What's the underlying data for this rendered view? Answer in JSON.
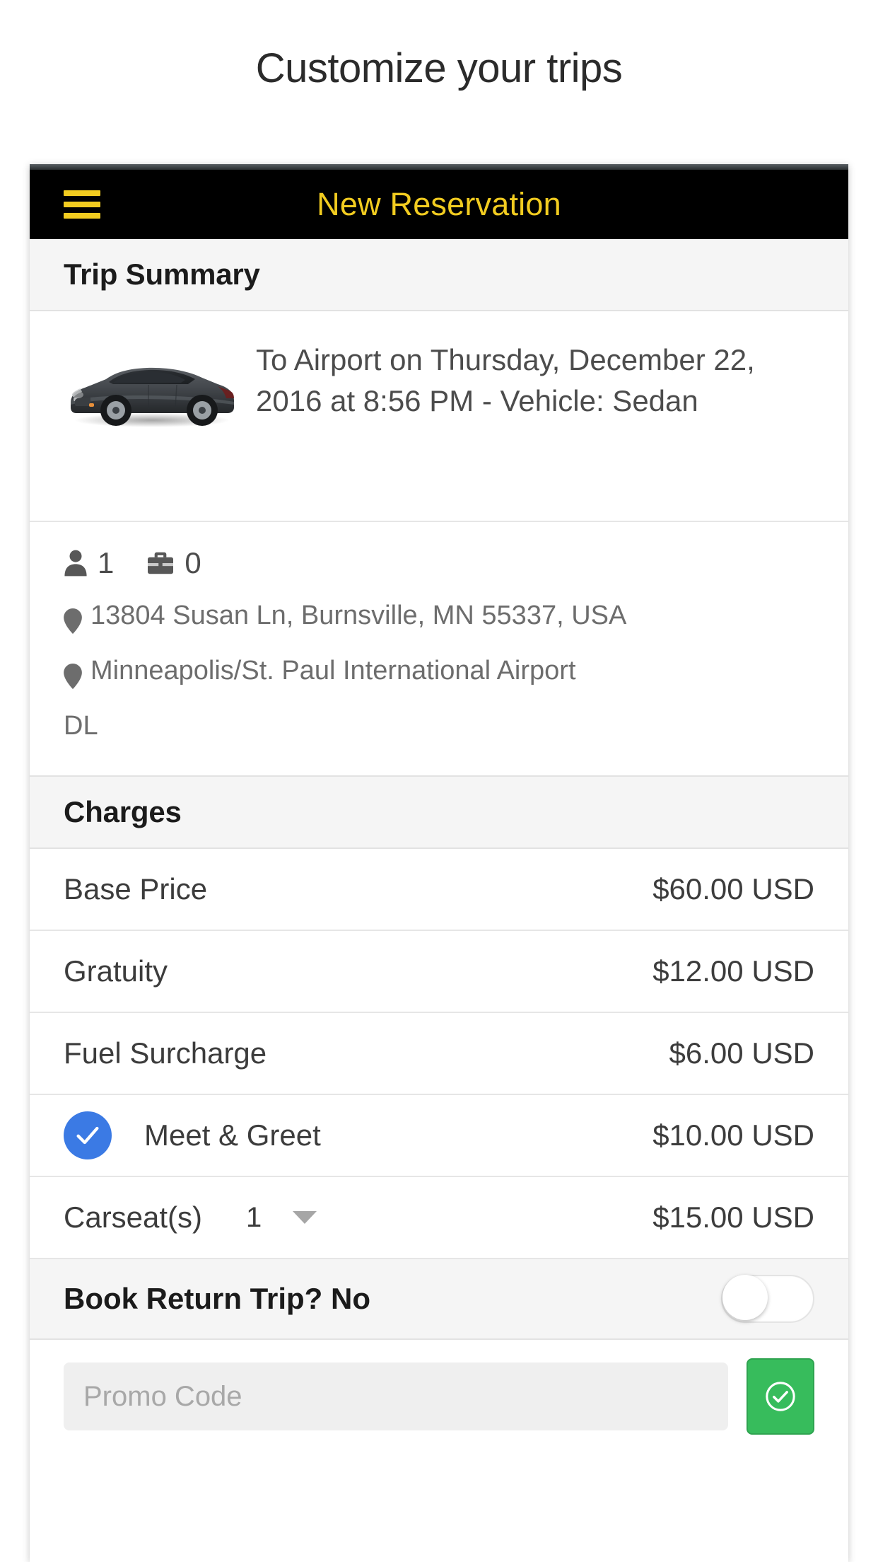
{
  "page": {
    "heading": "Customize your trips"
  },
  "navbar": {
    "menu_icon": "hamburger-menu-icon",
    "title": "New Reservation",
    "accent_color": "#f2cc20",
    "background_color": "#000000"
  },
  "trip_summary": {
    "header": "Trip Summary",
    "vehicle_image": "sedan-car-image",
    "description": "To Airport on Thursday, December 22, 2016 at 8:56 PM - Vehicle: Sedan",
    "passengers": {
      "icon": "person-icon",
      "count": "1"
    },
    "luggage": {
      "icon": "briefcase-icon",
      "count": "0"
    },
    "pickup_location": "13804 Susan Ln, Burnsville, MN 55337, USA",
    "dropoff_location": "Minneapolis/St. Paul International Airport",
    "airline_code": "DL"
  },
  "charges": {
    "header": "Charges",
    "rows": [
      {
        "label": "Base Price",
        "amount": "$60.00 USD",
        "selectable": false,
        "checked": false
      },
      {
        "label": "Gratuity",
        "amount": "$12.00 USD",
        "selectable": false,
        "checked": false
      },
      {
        "label": "Fuel Surcharge",
        "amount": "$6.00 USD",
        "selectable": false,
        "checked": false
      },
      {
        "label": "Meet & Greet",
        "amount": "$10.00 USD",
        "selectable": true,
        "checked": true
      },
      {
        "label": "Carseat(s)",
        "amount": "$15.00 USD",
        "quantity": "1",
        "selectable": false,
        "checked": false
      }
    ],
    "checkbox_color": "#3b7ae4"
  },
  "return_trip": {
    "label": "Book Return Trip? No",
    "toggle_state": "off"
  },
  "promo": {
    "placeholder": "Promo Code",
    "value": "",
    "apply_icon": "check-circle-icon",
    "apply_button_color": "#37bc5c"
  }
}
